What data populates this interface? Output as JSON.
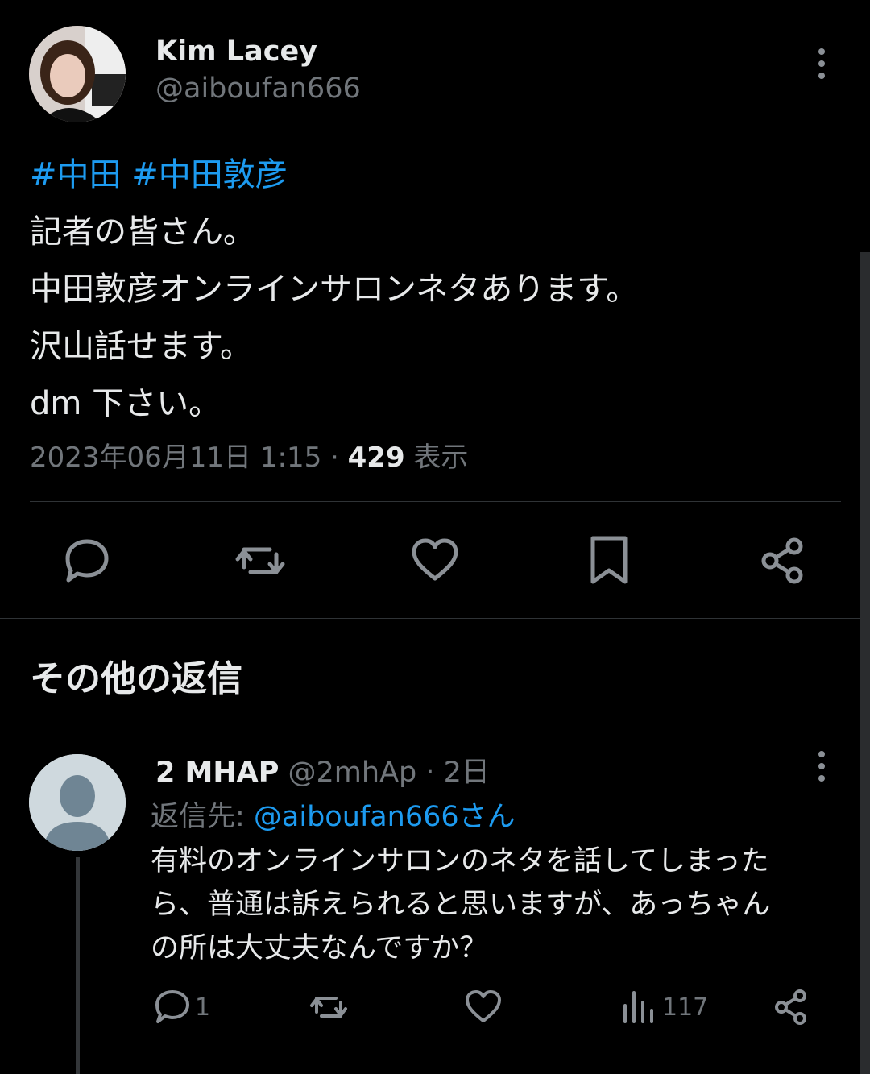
{
  "tweet": {
    "author_name": "Kim Lacey",
    "author_handle": "@aiboufan666",
    "hashtags": "#中田 #中田敦彦",
    "lines": [
      "記者の皆さん。",
      "中田敦彦オンラインサロンネタあります。",
      "沢山話せます。",
      "dm 下さい。"
    ],
    "timestamp": "2023年06月11日 1:15 · ",
    "views_count": "429",
    "views_label": " 表示",
    "actions": [
      "reply-icon",
      "retweet-icon",
      "like-icon",
      "bookmark-icon",
      "share-icon"
    ]
  },
  "section_title": "その他の返信",
  "reply": {
    "name": "2 MHAP",
    "handle_time": " @2mhAp · 2日",
    "reply_to_label": "返信先: ",
    "reply_to_mention": "@aiboufan666さん",
    "lines": [
      "有料のオンラインサロンのネタを話してしまった",
      "ら、普通は訴えられると思いますが、あっちゃん",
      "の所は大丈夫なんですか？"
    ],
    "reply_count": "1",
    "view_count": "117"
  },
  "colors": {
    "background": "#000000",
    "text": "#e7e9ea",
    "muted": "#71767b",
    "accent": "#1d9bf0",
    "divider": "#2f3336"
  }
}
